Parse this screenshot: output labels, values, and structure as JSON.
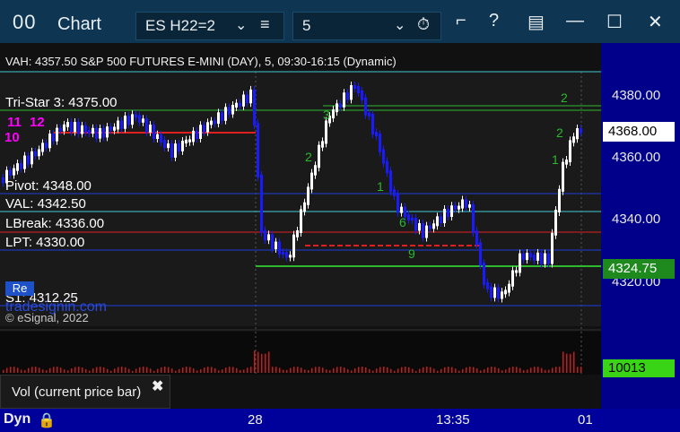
{
  "window": {
    "title_icon": "00",
    "title": "Chart",
    "symbol": "ES H22=2",
    "symbol_chevron": "⌄",
    "symbol_menu": "≡",
    "interval": "5",
    "interval_chevron": "⌄",
    "interval_clock": "⏱",
    "icons": {
      "pin": "⌐",
      "help": "?",
      "page": "▤",
      "minimize": "—",
      "maximize": "☐",
      "close": "✕"
    }
  },
  "chart": {
    "header": "VAH: 4357.50 S&P 500 FUTURES E-MINI (DAY), 5, 09:30-16:15 (Dynamic)",
    "labels": {
      "tristar": "Tri-Star 3: 4375.00",
      "pivot": "Pivot: 4348.00",
      "val": "VAL: 4342.50",
      "lbreak": "LBreak: 4336.00",
      "lpt": "LPT: 4330.00",
      "s1": "S1: 4312.25",
      "re": "Re"
    },
    "watermark": "tradesignin.com",
    "copyright": "© eSignal, 2022",
    "y_axis": [
      "4380.00",
      "4360.00",
      "4340.00",
      "4320.00"
    ],
    "current_price": "4368.00",
    "pivot_price": "4324.75",
    "volume_value": "10013",
    "volume_panel_label": "Vol (current price bar)",
    "volume_close": "✖",
    "x_axis": [
      "28",
      "13:35",
      "01"
    ],
    "bottom_label": "Dyn",
    "lock_icon": "🔒",
    "colors": {
      "up": "#ffffff",
      "down": "#1a1aff",
      "green_line": "#2db82d",
      "red_line": "#e02020",
      "blue_line": "#1e3ee0",
      "cyan_line": "#40c8d8",
      "volume": "#c71c1c"
    }
  }
}
